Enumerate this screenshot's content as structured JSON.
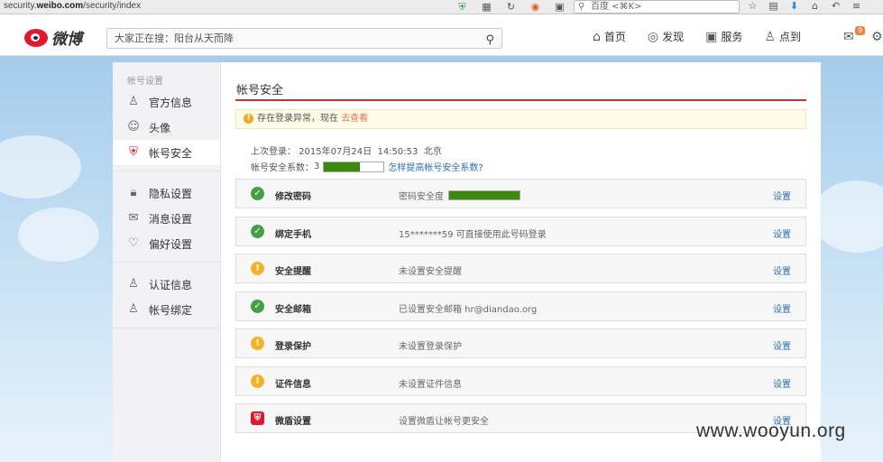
{
  "browser": {
    "url_prefix": "security.",
    "url_domain": "weibo.com",
    "url_path": "/security/index",
    "search_placeholder": "百度 <⌘K>"
  },
  "nav": {
    "logo_text": "微博",
    "search_placeholder": "大家正在搜：阳台从天而降",
    "items": [
      {
        "label": "首页",
        "icon": "home-icon"
      },
      {
        "label": "发现",
        "icon": "compass-icon"
      },
      {
        "label": "服务",
        "icon": "briefcase-icon"
      },
      {
        "label": "点到",
        "icon": "user-icon"
      }
    ],
    "mail_badge": "9"
  },
  "sidebar": {
    "group_title": "帐号设置",
    "items": [
      {
        "label": "官方信息",
        "icon": "profile-icon"
      },
      {
        "label": "头像",
        "icon": "avatar-icon"
      },
      {
        "label": "帐号安全",
        "icon": "shield-icon",
        "active": true
      },
      {
        "label": "隐私设置",
        "icon": "lock-icon"
      },
      {
        "label": "消息设置",
        "icon": "message-icon"
      },
      {
        "label": "偏好设置",
        "icon": "heart-settings-icon"
      },
      {
        "label": "认证信息",
        "icon": "verified-user-icon"
      },
      {
        "label": "帐号绑定",
        "icon": "bind-user-icon"
      }
    ]
  },
  "main": {
    "title": "帐号安全",
    "alert_text": "存在登录异常，现在",
    "alert_link": "去查看",
    "last_login_label": "上次登录：",
    "last_login_date": "2015年07月24日",
    "last_login_time": "14:50:53",
    "last_login_city": "北京",
    "score_label": "帐号安全系数：",
    "score_value": "3",
    "score_fraction": 0.6,
    "score_link": "怎样提高帐号安全系数?",
    "rows": [
      {
        "status": "ok",
        "name": "修改密码",
        "desc": "密码安全度",
        "action": "设置",
        "has_bar": true
      },
      {
        "status": "ok",
        "name": "绑定手机",
        "desc": "15*******59 可直接使用此号码登录",
        "action": "设置"
      },
      {
        "status": "warn",
        "name": "安全提醒",
        "desc": "未设置安全提醒",
        "action": "设置"
      },
      {
        "status": "ok",
        "name": "安全邮箱",
        "desc": "已设置安全邮箱 hr@diandao.org",
        "action": "设置"
      },
      {
        "status": "warn",
        "name": "登录保护",
        "desc": "未设置登录保护",
        "action": "设置"
      },
      {
        "status": "warn",
        "name": "证件信息",
        "desc": "未设置证件信息",
        "action": "设置"
      },
      {
        "status": "shield",
        "name": "微盾设置",
        "desc": "设置微盾让帐号更安全",
        "action": "设置"
      }
    ]
  },
  "watermark": "www.wooyun.org"
}
